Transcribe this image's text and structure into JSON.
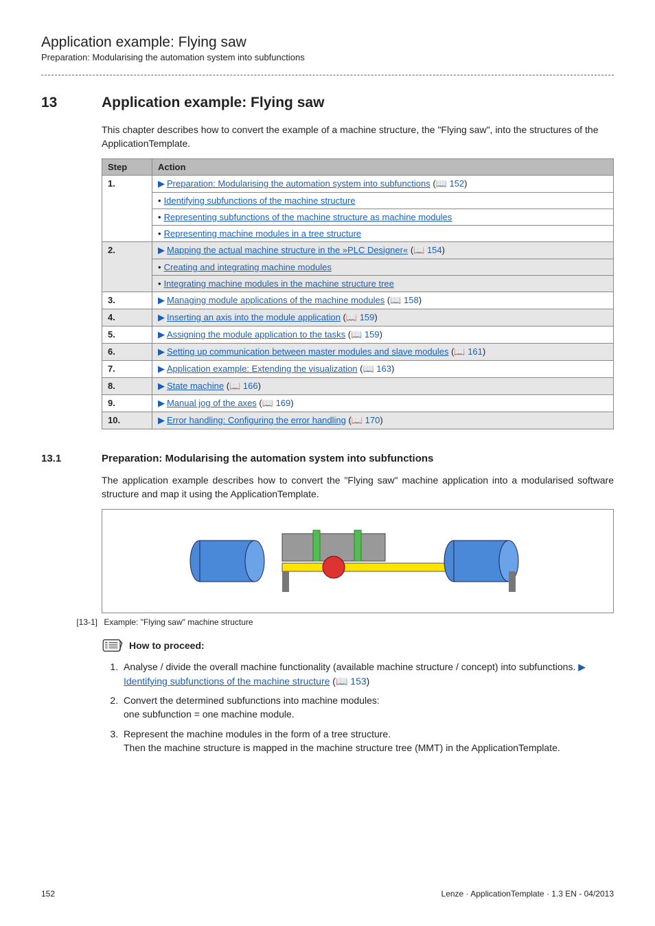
{
  "page": {
    "title": "Application example: Flying saw",
    "subtitle": "Preparation: Modularising the automation system into subfunctions"
  },
  "section": {
    "num": "13",
    "title": "Application example: Flying saw",
    "intro": "This chapter describes how to convert the example of a machine structure, the \"Flying saw\", into the structures of the ApplicationTemplate."
  },
  "table": {
    "headers": {
      "step": "Step",
      "action": "Action"
    },
    "rows": [
      {
        "num": "1.",
        "alt": false,
        "items": [
          {
            "tri": true,
            "text": "Preparation: Modularising the automation system into subfunctions",
            "ref": "152"
          },
          {
            "tri": false,
            "text": "Identifying subfunctions of the machine structure"
          },
          {
            "tri": false,
            "text": "Representing subfunctions of the machine structure as machine modules"
          },
          {
            "tri": false,
            "text": "Representing machine modules in a tree structure"
          }
        ]
      },
      {
        "num": "2.",
        "alt": true,
        "items": [
          {
            "tri": true,
            "text": "Mapping the actual machine structure in the »PLC Designer«",
            "ref": "154"
          },
          {
            "tri": false,
            "text": "Creating and integrating machine modules"
          },
          {
            "tri": false,
            "text": "Integrating machine modules in the machine structure tree"
          }
        ]
      },
      {
        "num": "3.",
        "alt": false,
        "items": [
          {
            "tri": true,
            "text": "Managing module applications of the machine modules",
            "ref": "158"
          }
        ]
      },
      {
        "num": "4.",
        "alt": true,
        "items": [
          {
            "tri": true,
            "text": "Inserting an axis into the module application",
            "ref": "159"
          }
        ]
      },
      {
        "num": "5.",
        "alt": false,
        "items": [
          {
            "tri": true,
            "text": "Assigning the module application to the tasks",
            "ref": "159"
          }
        ]
      },
      {
        "num": "6.",
        "alt": true,
        "items": [
          {
            "tri": true,
            "text": "Setting up communication between master modules and slave modules",
            "ref": "161"
          }
        ]
      },
      {
        "num": "7.",
        "alt": false,
        "items": [
          {
            "tri": true,
            "text": "Application example: Extending the visualization",
            "ref": "163"
          }
        ]
      },
      {
        "num": "8.",
        "alt": true,
        "items": [
          {
            "tri": true,
            "text": "State machine",
            "ref": "166"
          }
        ]
      },
      {
        "num": "9.",
        "alt": false,
        "items": [
          {
            "tri": true,
            "text": "Manual jog of the axes",
            "ref": "169"
          }
        ]
      },
      {
        "num": "10.",
        "alt": true,
        "items": [
          {
            "tri": true,
            "text": "Error handling: Configuring the error handling",
            "ref": "170"
          }
        ]
      }
    ]
  },
  "subsection": {
    "num": "13.1",
    "title": "Preparation: Modularising the automation system into subfunctions",
    "intro": "The application example describes how to convert the \"Flying saw\" machine application into a modularised software structure and map it using the ApplicationTemplate."
  },
  "figure": {
    "label": "[13-1]",
    "caption": "Example: \"Flying saw\" machine structure"
  },
  "proceed": {
    "heading": "How to proceed:",
    "items": [
      {
        "pre": "Analyse / divide the overall machine functionality (available machine structure / concept) into subfunctions.  ",
        "link": "Identifying subfunctions of the machine structure",
        "ref": "153",
        "post": ""
      },
      {
        "pre": "Convert the determined subfunctions into machine modules:\none subfunction = one machine module.",
        "link": "",
        "ref": "",
        "post": ""
      },
      {
        "pre": "Represent the machine modules in the form of a tree structure.\nThen the machine structure is mapped in the machine structure tree (MMT) in the ApplicationTemplate.",
        "link": "",
        "ref": "",
        "post": ""
      }
    ]
  },
  "footer": {
    "page": "152",
    "right": "Lenze · ApplicationTemplate · 1.3 EN - 04/2013"
  }
}
